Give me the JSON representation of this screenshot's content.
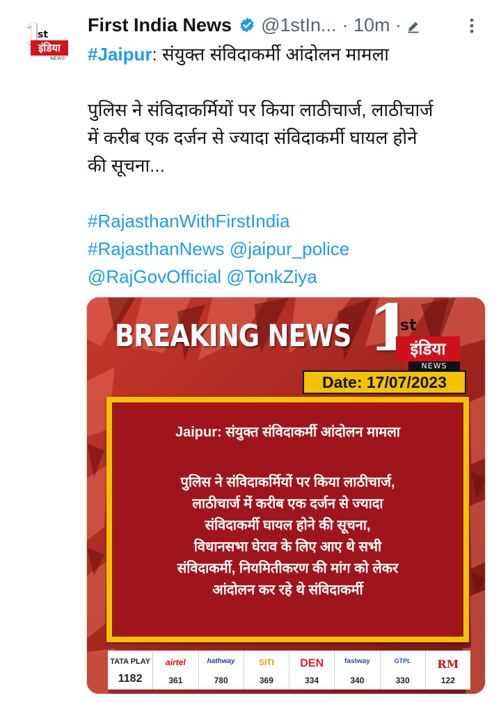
{
  "tweet": {
    "author_name": "First India News",
    "handle": "@1stIn...",
    "time": "· 10m ·",
    "text_line1_hashtag": "#Jaipur",
    "text_line1_rest": ": संयुक्त संविदाकर्मी आंदोलन मामला",
    "text_para2_line1": "पुलिस ने संविदाकर्मियों पर किया लाठीचार्ज, लाठीचार्ज",
    "text_para2_line2": "में करीब एक दर्जन से ज्यादा संविदाकर्मी घायल होने",
    "text_para2_line3": "की सूचना...",
    "hashtag_1": "#RajasthanWithFirstIndia",
    "hashtag_2": "#RajasthanNews",
    "mention_1": "@jaipur_police",
    "mention_2": "@RajGovOfficial",
    "mention_3": "@TonkZiya"
  },
  "avatar": {
    "one": "1",
    "st": "st",
    "brand": "इंडिया",
    "news": "NEWS"
  },
  "media": {
    "headline": "BREAKING NEWS",
    "logo_one": "1",
    "logo_st": "st",
    "logo_brand": "इंडिया",
    "logo_news": "NEWS",
    "date": "Date: 17/07/2023",
    "panel_title": "Jaipur: संयुक्त संविदाकर्मी आंदोलन मामला",
    "panel_lines": [
      "पुलिस ने संविदाकर्मियों पर किया लाठीचार्ज,",
      "लाठीचार्ज में करीब एक दर्जन से ज्यादा",
      "संविदाकर्मी घायल होने की सूचना,",
      "विधानसभा घेराव के लिए आए थे सभी",
      "संविदाकर्मी, नियमितीकरण की मांग को लेकर",
      "आंदोलन कर रहे थे संविदाकर्मी"
    ],
    "channels": [
      {
        "logo": "TATA PLAY",
        "number": "1182"
      },
      {
        "logo": "airtel",
        "number": "361"
      },
      {
        "logo": "hathway",
        "number": "780"
      },
      {
        "logo": "SITI",
        "number": "369"
      },
      {
        "logo": "DEN",
        "number": "334"
      },
      {
        "logo": "fastway",
        "number": "340"
      },
      {
        "logo": "GTPL",
        "number": "330"
      },
      {
        "logo": "RM",
        "number": "122"
      }
    ]
  },
  "colors": {
    "link": "#1d9bf0",
    "verified": "#1d9bf0",
    "panel_red": "#a0151b",
    "panel_border": "#f3c200",
    "brand_red": "#d0101a"
  },
  "icons": [
    "verified-badge-icon",
    "pencil-icon",
    "more-options-icon"
  ]
}
